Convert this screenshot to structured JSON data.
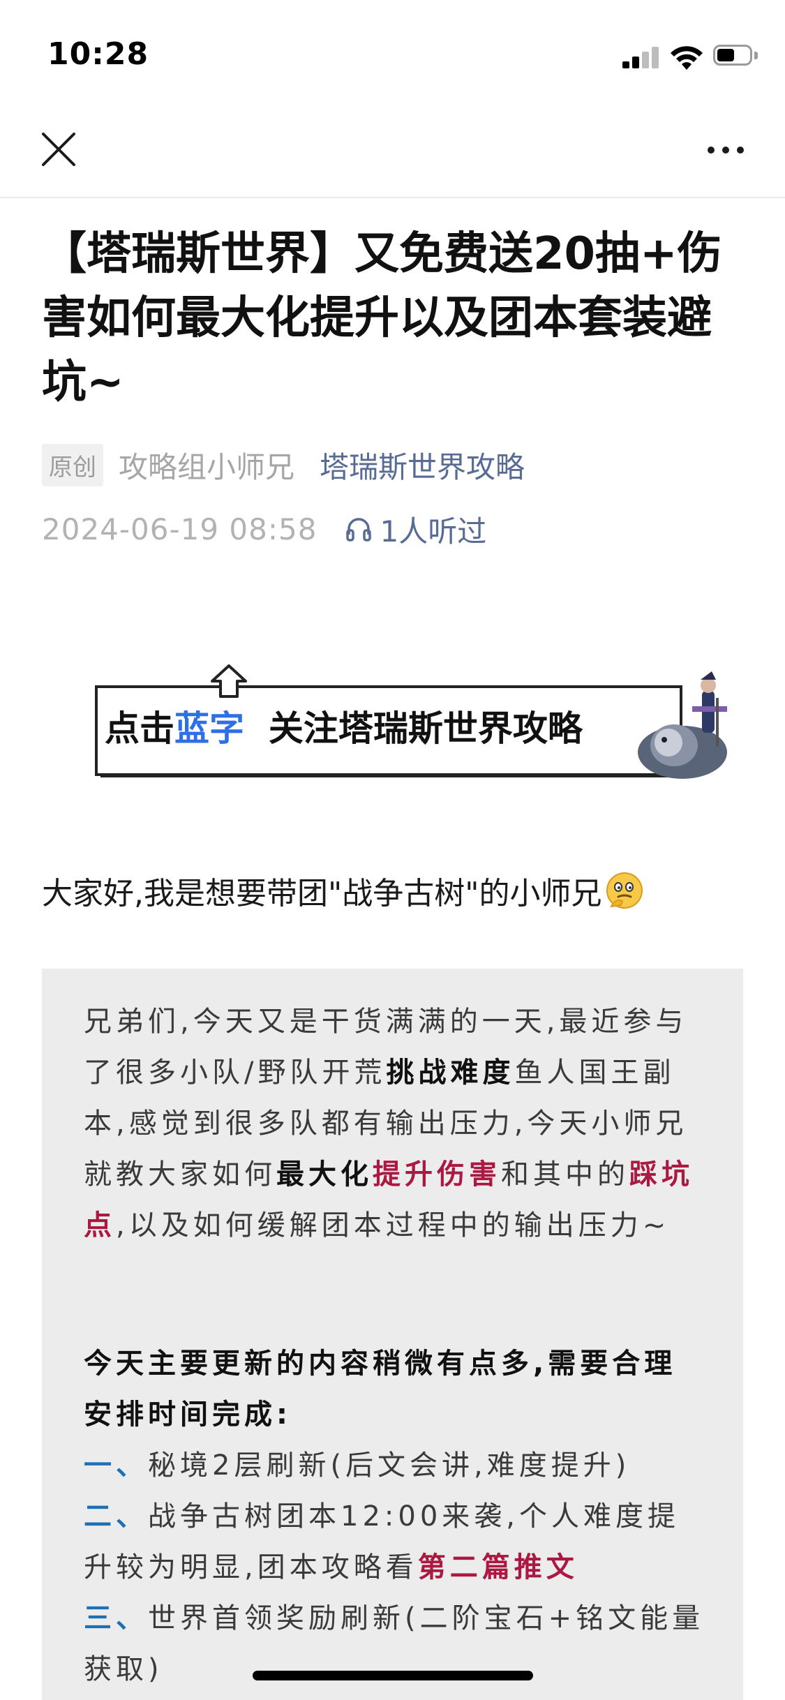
{
  "status_bar": {
    "time": "10:28"
  },
  "article": {
    "title": "【塔瑞斯世界】又免费送20抽+伤害如何最大化提升以及团本套装避坑~",
    "badge": "原创",
    "author": "攻略组小师兄",
    "account": "塔瑞斯世界攻略",
    "date": "2024-06-19 08:58",
    "listen_count": "1人听过"
  },
  "banner": {
    "text_prefix": "点击",
    "text_blue": "蓝字",
    "text_suffix": "关注塔瑞斯世界攻略"
  },
  "intro": "大家好,我是想要带团\"战争古树\"的小师兄",
  "quote": {
    "p1_a": "兄弟们,今天又是干货满满的一天,最近参与了很多小队/野队开荒",
    "p1_b": "挑战难度",
    "p1_c": "鱼人国王副本,感觉到很多队都有输出压力,今天小师兄就教大家如何",
    "p1_d": "最大化",
    "p1_e": "提升伤害",
    "p1_f": "和其中的",
    "p1_g": "踩坑点",
    "p1_h": ",以及如何缓解团本过程中的输出压力~",
    "p2": "今天主要更新的内容稍微有点多,需要合理安排时间完成:",
    "item1_num": "一、",
    "item1_text": "秘境2层刷新(后文会讲,难度提升)",
    "item2_num": "二、",
    "item2_text": "战争古树团本12:00来袭,个人难度提升较为明显,团本攻略看",
    "item2_link": "第二篇推文",
    "item3_num": "三、",
    "item3_text": "世界首领奖励刷新(二阶宝石+铭文能量获取)"
  }
}
